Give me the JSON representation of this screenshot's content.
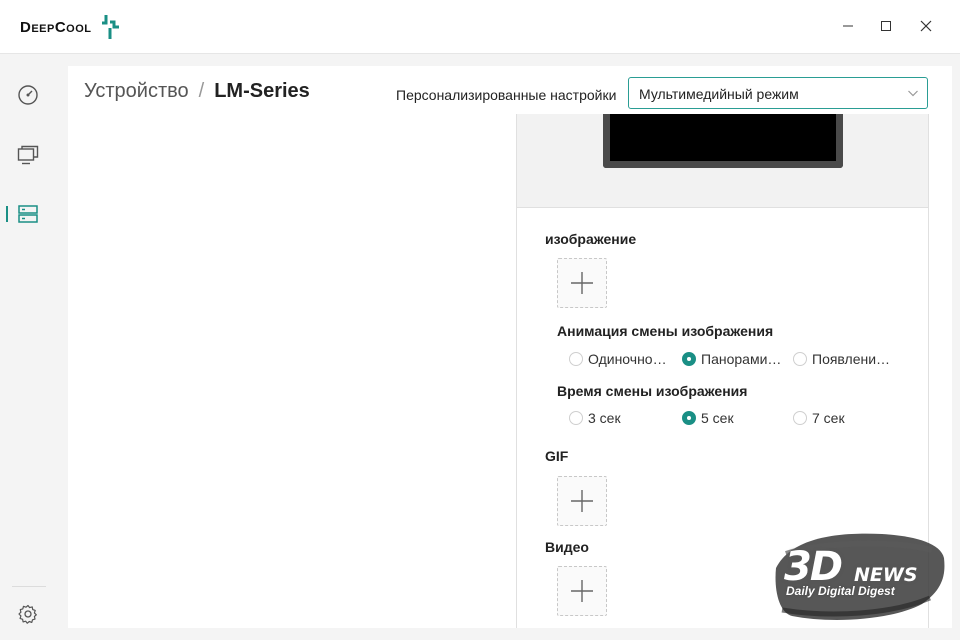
{
  "app": {
    "logo_text": "DeepCool",
    "accent_color": "#1a8f85"
  },
  "window_controls": [
    "minimize-icon",
    "maximize-icon",
    "close-icon"
  ],
  "sidebar": {
    "items": [
      {
        "name": "dashboard",
        "icon": "gauge-icon",
        "active": false
      },
      {
        "name": "monitor",
        "icon": "monitor-icon",
        "active": false
      },
      {
        "name": "devices",
        "icon": "server-icon",
        "active": true
      }
    ],
    "footer_icon": "gear-icon"
  },
  "breadcrumb": {
    "device": "Устройство",
    "separator": "/",
    "current": "LM-Series"
  },
  "preset": {
    "label": "Персонализированные настройки",
    "value": "Мультимедийный режим"
  },
  "image_section": {
    "title": "изображение",
    "animation": {
      "title": "Анимация смены изображения",
      "options": [
        "Одиночно…",
        "Панорами…",
        "Появлени…"
      ],
      "selected": 1
    },
    "interval": {
      "title": "Время смены изображения",
      "options": [
        "3 сек",
        "5 сек",
        "7 сек"
      ],
      "selected": 1
    }
  },
  "gif_section": {
    "title": "GIF"
  },
  "video_section": {
    "title": "Видео"
  },
  "watermark": {
    "brand_big": "3D",
    "brand_news": "NEWS",
    "tagline": "Daily Digital Digest"
  }
}
